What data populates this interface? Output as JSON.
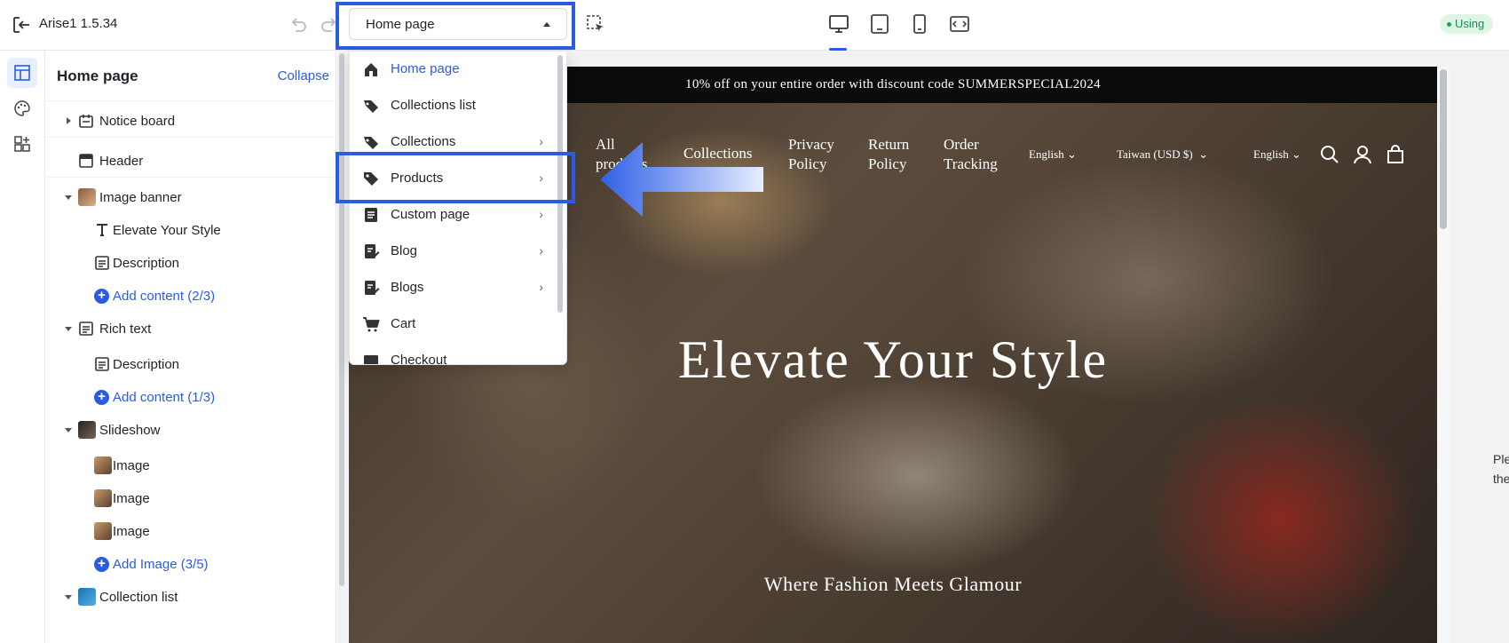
{
  "app": {
    "title": "Arise1  1.5.34",
    "status": "Using"
  },
  "page_select": {
    "value": "Home page"
  },
  "panel": {
    "title": "Home page",
    "collapse": "Collapse",
    "tree": [
      {
        "label": "Notice board",
        "level": 0,
        "expand": "right",
        "icon": "notice-board-icon"
      },
      {
        "label": "Header",
        "level": 0,
        "expand": "none",
        "icon": "header-icon"
      },
      {
        "label": "Image banner",
        "level": 0,
        "expand": "down",
        "icon": "image-banner-thumbnail"
      },
      {
        "label": "Elevate Your Style",
        "level": 1,
        "icon": "text-icon"
      },
      {
        "label": "Description",
        "level": 1,
        "icon": "description-icon"
      },
      {
        "label": "Add content (2/3)",
        "level": 1,
        "icon": "add-icon",
        "add": true
      },
      {
        "label": "Rich text",
        "level": 0,
        "expand": "down",
        "icon": "rich-text-icon"
      },
      {
        "label": "Description",
        "level": 1,
        "icon": "description-icon"
      },
      {
        "label": "Add content (1/3)",
        "level": 1,
        "icon": "add-icon",
        "add": true
      },
      {
        "label": "Slideshow",
        "level": 0,
        "expand": "down",
        "icon": "slideshow-thumbnail"
      },
      {
        "label": "Image",
        "level": 1,
        "icon": "image-thumbnail"
      },
      {
        "label": "Image",
        "level": 1,
        "icon": "image-thumbnail"
      },
      {
        "label": "Image",
        "level": 1,
        "icon": "image-thumbnail"
      },
      {
        "label": "Add Image (3/5)",
        "level": 1,
        "icon": "add-icon",
        "add": true
      },
      {
        "label": "Collection list",
        "level": 0,
        "expand": "down",
        "icon": "collection-list-thumbnail"
      }
    ]
  },
  "dropdown": {
    "items": [
      {
        "label": "Home page",
        "icon": "home-icon",
        "submenu": false,
        "active": true
      },
      {
        "label": "Collections list",
        "icon": "tags-icon",
        "submenu": false
      },
      {
        "label": "Collections",
        "icon": "tags-icon",
        "submenu": true
      },
      {
        "label": "Products",
        "icon": "tag-icon",
        "submenu": true
      },
      {
        "label": "Custom page",
        "icon": "page-icon",
        "submenu": true
      },
      {
        "label": "Blog",
        "icon": "blog-icon",
        "submenu": true
      },
      {
        "label": "Blogs",
        "icon": "blog-icon",
        "submenu": true
      },
      {
        "label": "Cart",
        "icon": "cart-icon",
        "submenu": false
      },
      {
        "label": "Checkout",
        "icon": "checkout-icon",
        "submenu": false
      }
    ]
  },
  "store": {
    "announcement": "10% off on your entire order with discount code SUMMERSPECIAL2024",
    "nav": {
      "all_products_1": "All",
      "all_products_2": "products",
      "collections": "Collections",
      "privacy_1": "Privacy",
      "privacy_2": "Policy",
      "return_1": "Return",
      "return_2": "Policy",
      "order_1": "Order",
      "order_2": "Tracking",
      "lang_1": "English",
      "currency": "Taiwan  (USD $)",
      "lang_2": "English"
    },
    "hero_title": "Elevate Your Style",
    "hero_subtitle": "Where Fashion Meets Glamour"
  },
  "right_note": {
    "line1": "Ple",
    "line2": "the"
  },
  "colors": {
    "accent": "#2b5be0",
    "using_badge_bg": "#dff5e7",
    "announcement_bg": "#0b0b0b"
  }
}
